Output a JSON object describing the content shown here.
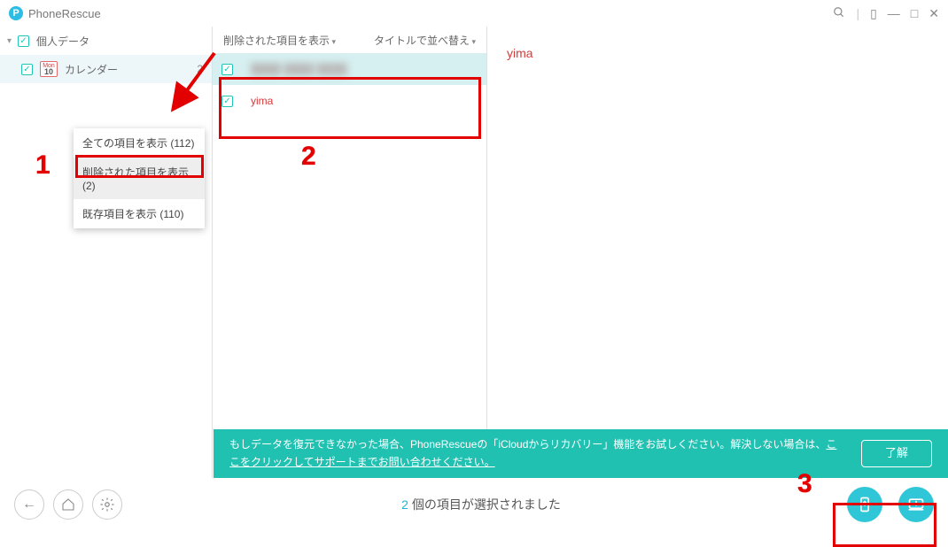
{
  "header": {
    "app_name": "PhoneRescue"
  },
  "sidebar": {
    "root_label": "個人データ",
    "items": [
      {
        "label": "カレンダー",
        "count": "2"
      }
    ]
  },
  "context_menu": {
    "items": [
      "全ての項目を表示 (112)",
      "削除された項目を表示 (2)",
      "既存項目を表示 (110)"
    ],
    "highlight_index": 1
  },
  "list": {
    "filter_label": "削除された項目を表示",
    "sort_label": "タイトルで並べ替え",
    "rows": [
      {
        "text": "████ ████ ████",
        "blurred": true,
        "selected": true
      },
      {
        "text": "yima",
        "blurred": false,
        "selected": false
      }
    ]
  },
  "detail": {
    "title": "yima"
  },
  "banner": {
    "text_prefix": "もしデータを復元できなかった場合、PhoneRescueの「iCloudからリカバリー」機能をお試しください。解決しない場合は、",
    "link_text": "ここをクリックしてサポートまでお問い合わせください。",
    "ok_label": "了解"
  },
  "bottom": {
    "count": "2",
    "suffix": " 個の項目が選択されました"
  },
  "annotations": {
    "nums": [
      "1",
      "2",
      "3"
    ]
  }
}
